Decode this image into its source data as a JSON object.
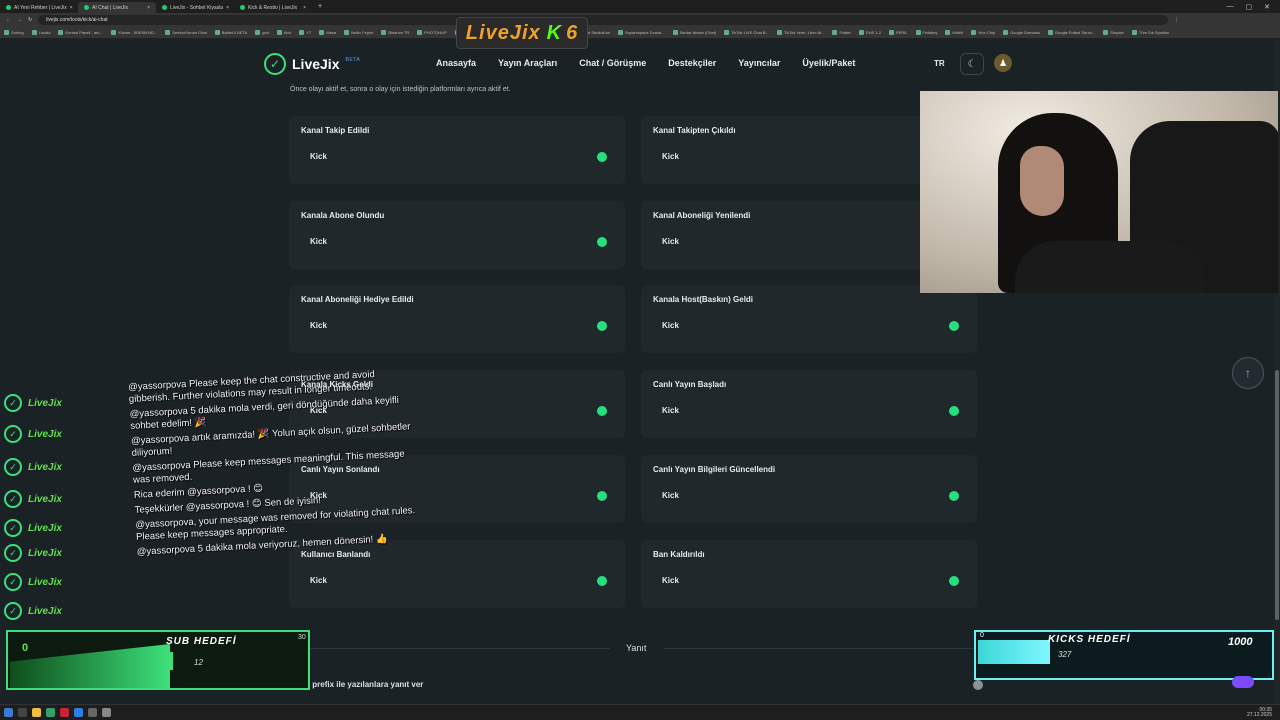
{
  "browser": {
    "tabs": [
      {
        "label": "AI Yeni Rehber | LiveJix"
      },
      {
        "label": "AI Chat | LiveJix",
        "active": true
      },
      {
        "label": "LiveJix - Sohbet Kiyasla"
      },
      {
        "label": "Kick & Restio | LiveJix"
      }
    ],
    "url": "livejix.com/tools/kick/ai-chat",
    "bookmarks": [
      "Sorting",
      "Lucida",
      "Kontrol Paneli - anı...",
      "Yüzme - 5DEKIKHD...",
      "SembolYorum Chat",
      "BattleUI BETA",
      "gvd",
      "Kick",
      "YT",
      "Mesa",
      "Netlix Feyrin",
      "Binance TR",
      "PHOTOHUP",
      "CyberPanel",
      "Copy B...",
      "Capacitor by Ionic",
      "Convert Studioll.an",
      "Squarespace Domai...",
      "Sardar Ahsan (Chat)",
      "TikTok LIVE Chat B...",
      "TikTok Yeter, Libro At...",
      "Flutter",
      "DNS 1.2",
      "PERIL",
      "Fixfakey",
      "Möbili",
      "Yine Chip",
      "Google Domains",
      "Google Edited Struct...",
      "Shopier",
      "Tüm Sık Sportlar"
    ],
    "new_tab": "+",
    "window_controls": [
      "—",
      "▢",
      "✕"
    ]
  },
  "stream_brand": {
    "text": "LiveJix",
    "k": "K",
    "num": "6"
  },
  "header": {
    "logo_text": "LiveJix",
    "logo_badge": "BETA",
    "nav": [
      "Anasayfa",
      "Yayın Araçları",
      "Chat / Görüşme",
      "Destekçiler",
      "Yayıncılar",
      "Üyelik/Paket"
    ],
    "lang": "TR"
  },
  "intro": "Önce olayı aktif et, sonra o olay için istediğin platformları ayrıca aktif et.",
  "events_left": [
    {
      "title": "Kanal Takip Edildi",
      "platform": "Kick",
      "on": true
    },
    {
      "title": "Kanala Abone Olundu",
      "platform": "Kick",
      "on": true
    },
    {
      "title": "Kanal Aboneliği Hediye Edildi",
      "platform": "Kick",
      "on": true
    },
    {
      "title": "Kanala Kicks Geldi",
      "platform": "Kick",
      "on": true
    },
    {
      "title": "Canlı Yayın Sonlandı",
      "platform": "Kick",
      "on": true
    },
    {
      "title": "Kullanıcı Banlandı",
      "platform": "Kick",
      "on": true
    }
  ],
  "events_right": [
    {
      "title": "Kanal Takipten Çıkıldı",
      "platform": "Kick",
      "on": true
    },
    {
      "title": "Kanal Aboneliği Yenilendi",
      "platform": "Kick",
      "on": true
    },
    {
      "title": "Kanala Host(Baskın) Geldi",
      "platform": "Kick",
      "on": true
    },
    {
      "title": "Canlı Yayın Başladı",
      "platform": "Kick",
      "on": true
    },
    {
      "title": "Canlı Yayın Bilgileri Güncellendi",
      "platform": "Kick",
      "on": true
    },
    {
      "title": "Ban Kaldırıldı",
      "platform": "Kick",
      "on": true
    }
  ],
  "reply": {
    "label": "Yanıt",
    "prefix_label": "Sadece prefix ile yazılanlara yanıt ver",
    "prefix_on": false
  },
  "chat_overlay": {
    "usernames": [
      "LiveJix",
      "LiveJix",
      "LiveJix",
      "LiveJix",
      "LiveJix",
      "LiveJix",
      "LiveJix",
      "LiveJix"
    ],
    "messages": [
      "@yassorpova Please keep the chat constructive and avoid gibberish. Further violations may result in longer timeouts.",
      "@yassorpova 5 dakika mola verdi, geri döndüğünde daha keyifli sohbet edelim! 🎉",
      "@yassorpova artık aramızda! 🎉 Yolun açık olsun, güzel sohbetler diliyorum!",
      "@yassorpova Please keep messages meaningful. This message was removed.",
      "Rica ederim @yassorpova ! 😊",
      "Teşekkürler @yassorpova ! 😊 Sen de iyisin!",
      "@yassorpova, your message was removed for violating chat rules. Please keep messages appropriate.",
      "@yassorpova 5 dakika mola veriyoruz, hemen dönersin! 👍"
    ]
  },
  "sub_goal": {
    "title": "SUB HEDEFİ",
    "current": "0",
    "mid": "12",
    "target": "30"
  },
  "kicks_goal": {
    "title": "KICKS HEDEFİ",
    "current": "0",
    "mid": "327",
    "target": "1000"
  },
  "taskbar": {
    "time": "00:35",
    "date": "27.12.2025"
  }
}
